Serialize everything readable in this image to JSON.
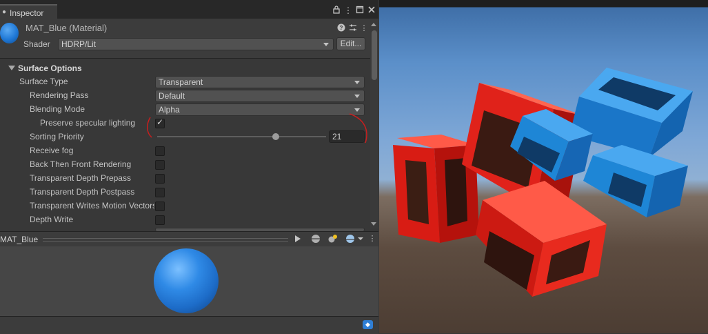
{
  "inspector": {
    "tab_label": "Inspector",
    "tab_icon": "info-icon",
    "material_title": "MAT_Blue (Material)",
    "shader_label": "Shader",
    "shader_value": "HDRP/Lit",
    "edit_button": "Edit...",
    "section_title": "Surface Options",
    "properties": [
      {
        "label": "Surface Type",
        "control": "dropdown",
        "value": "Transparent"
      },
      {
        "label": "Rendering Pass",
        "control": "dropdown",
        "value": "Default"
      },
      {
        "label": "Blending Mode",
        "control": "dropdown",
        "value": "Alpha"
      },
      {
        "label": "Preserve specular lighting",
        "control": "checkbox",
        "checked": true
      },
      {
        "label": "Sorting Priority",
        "control": "slider",
        "value": "21"
      },
      {
        "label": "Receive fog",
        "control": "checkbox",
        "checked": false
      },
      {
        "label": "Back Then Front Rendering",
        "control": "checkbox",
        "checked": false
      },
      {
        "label": "Transparent Depth Prepass",
        "control": "checkbox",
        "checked": false
      },
      {
        "label": "Transparent Depth Postpass",
        "control": "checkbox",
        "checked": false
      },
      {
        "label": "Transparent Writes Motion Vectors",
        "control": "checkbox",
        "checked": false
      },
      {
        "label": "Depth Write",
        "control": "checkbox",
        "checked": false
      }
    ],
    "checkmark_glyph": "✓",
    "preview_title": "MAT_Blue"
  },
  "colors": {
    "panel_bg": "#383838",
    "accent_blue": "#1f78d6",
    "annotation_red": "#c81e1e",
    "cube_red": "#e8281e",
    "cube_blue": "#1e86d6"
  }
}
